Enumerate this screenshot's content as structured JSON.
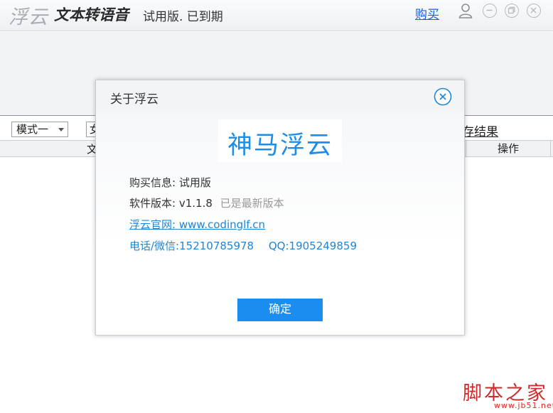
{
  "titlebar": {
    "brand": "浮云",
    "app_title": "文本转语音",
    "trial_status": "试用版. 已到期",
    "buy_label": "购买"
  },
  "toolbar": {
    "mode_value": "模式一",
    "voice_value": "女",
    "save_result_label": "存结果"
  },
  "table": {
    "headers": [
      "文",
      "操作"
    ]
  },
  "dialog": {
    "title": "关于浮云",
    "logo_text": "神马浮云",
    "purchase_info_label": "购买信息:",
    "purchase_info_value": "试用版",
    "version_label": "软件版本:",
    "version_value": "v1.1.8",
    "version_status": "已是最新版本",
    "website_label": "浮云官网:",
    "website_url": "www.codinglf.cn",
    "phone_label": "电话/微信:",
    "phone_value": "15210785978",
    "qq_label": "QQ:",
    "qq_value": "1905249859",
    "ok_label": "确定"
  },
  "watermark": {
    "text": "脚本之家",
    "url": "www.jb51.net"
  },
  "colors": {
    "accent": "#1b8cf0",
    "link": "#1d86d8",
    "watermark": "#d12a2a"
  },
  "icons": [
    "user-icon",
    "minimize-icon",
    "restore-icon",
    "close-icon",
    "dialog-close-icon",
    "dropdown-arrow-icon"
  ]
}
